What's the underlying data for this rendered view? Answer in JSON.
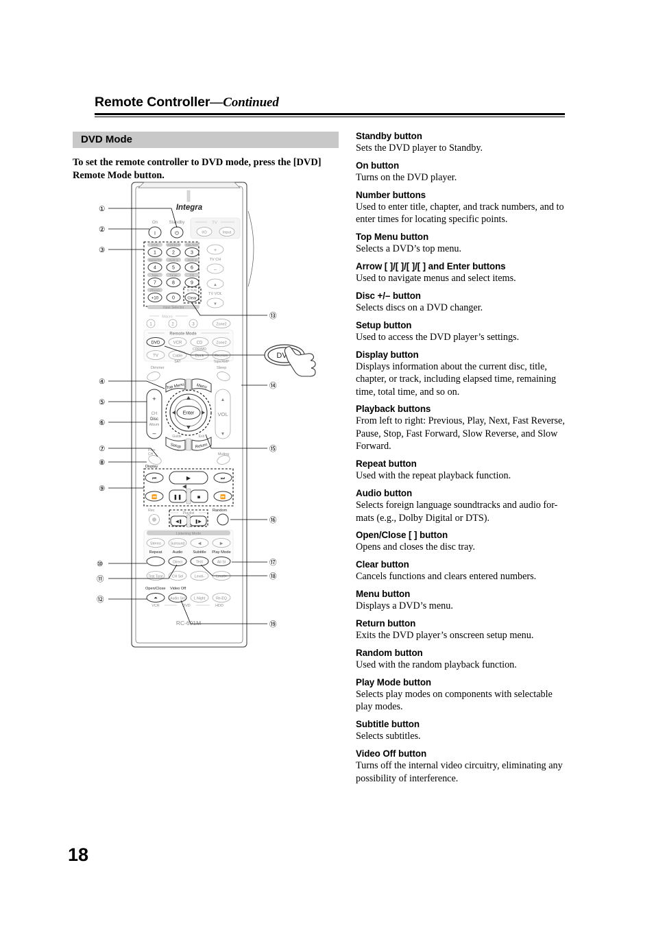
{
  "header": {
    "title_main": "Remote Controller",
    "title_cont": "—Continued"
  },
  "left": {
    "section_title": "DVD Mode",
    "intro": "To set the remote controller to DVD mode, press the [DVD] Remote Mode button."
  },
  "right": {
    "entries": [
      {
        "title": "Standby button",
        "body": "Sets the DVD player to Standby."
      },
      {
        "title": "On button",
        "body": "Turns on the DVD player."
      },
      {
        "title": "Number buttons",
        "body": "Used to enter title, chapter, and track numbers, and to enter times for locating specific points."
      },
      {
        "title": "Top Menu button",
        "body": "Selects a DVD’s top menu."
      },
      {
        "title": "Arrow [   ]/[   ]/[   ]/[   ] and Enter buttons",
        "body": "Used to navigate menus and select items."
      },
      {
        "title": "Disc +/– button",
        "body": "Selects discs on a DVD changer."
      },
      {
        "title": "Setup button",
        "body": "Used to access the DVD player’s settings."
      },
      {
        "title": "Display button",
        "body": "Displays information about the current disc, title, chapter, or track, including elapsed time, remaining time, total time, and so on."
      },
      {
        "title": "Playback buttons",
        "body": "From left to right: Previous, Play, Next, Fast Reverse, Pause, Stop, Fast Forward, Slow Reverse, and Slow Forward."
      },
      {
        "title": "Repeat button",
        "body": "Used with the repeat playback function."
      },
      {
        "title": "Audio button",
        "body": "Selects foreign language soundtracks and audio for-mats (e.g., Dolby Digital or DTS)."
      },
      {
        "title": "Open/Close [   ] button",
        "body": "Opens and closes the disc tray."
      },
      {
        "title": "Clear button",
        "body": "Cancels functions and clears entered numbers."
      },
      {
        "title": "Menu button",
        "body": "Displays a DVD’s menu."
      },
      {
        "title": "Return button",
        "body": "Exits the DVD player’s onscreen setup menu."
      },
      {
        "title": "Random button",
        "body": "Used with the random playback function."
      },
      {
        "title": "Play Mode button",
        "body": "Selects play modes on components with selectable play modes."
      },
      {
        "title": "Subtitle button",
        "body": "Selects subtitles."
      },
      {
        "title": "Video Off button",
        "body": "Turns off the internal video circuitry, eliminating any possibility of interference."
      }
    ]
  },
  "figure": {
    "brand": "Integra",
    "model": "RC-691M",
    "callout_button_label": "DVD",
    "callouts_left": [
      "①",
      "②",
      "③",
      "④",
      "⑤",
      "⑥",
      "⑦",
      "⑧",
      "⑨",
      "⑩",
      "⑪",
      "⑫"
    ],
    "callouts_right": [
      "⑬",
      "⑭",
      "⑮",
      "⑯",
      "⑰",
      "⑱",
      "⑲"
    ],
    "power": {
      "on": "On",
      "standby": "Standby"
    },
    "tv_group": {
      "label": "TV",
      "power": "I/⏻",
      "input": "Input"
    },
    "keypad": {
      "top_labels": [
        "DVD",
        "VCR/DVR",
        "CBL/SAT",
        "Game/TV",
        "AUX 1",
        "AUX 2",
        "Tape",
        "Tuner",
        "CD",
        "Phono"
      ],
      "keys": [
        "1",
        "2",
        "3",
        "4",
        "5",
        "6",
        "7",
        "8",
        "9",
        "+10",
        "0"
      ],
      "dtun_label": "D.TUN",
      "clear_key": "Clear",
      "selector_label": "Input Selector"
    },
    "tv_side": {
      "ch": "TV CH",
      "vol": "TV VOL",
      "plus": "+",
      "minus": "–",
      "up": "▲",
      "down": "▼"
    },
    "macro": {
      "label": "Macro",
      "keys": [
        "1",
        "2",
        "3"
      ],
      "zone": "Zone2"
    },
    "remote_mode": {
      "label": "Remote Mode",
      "row1": [
        "DVD",
        "VCR",
        "CD",
        "Zone2"
      ],
      "row1_sub": [
        "",
        "",
        "CDR/MD",
        ""
      ],
      "row2": [
        "TV",
        "Cable",
        "Dock",
        "Receiver"
      ],
      "row2_sub": [
        "",
        "SAT",
        "",
        "Tape/AMP"
      ]
    },
    "nav": {
      "dimmer": "Dimmer",
      "sleep": "Sleep",
      "top_menu": "Top Menu",
      "menu": "Menu",
      "enter": "Enter",
      "disc_plus": "+",
      "disc_minus": "–",
      "ch": "CH",
      "disc": "Disc",
      "album": "Album",
      "vol": "VOL",
      "setup": "Setup",
      "return": "Return",
      "prev_ch": "Prev CH",
      "muting": "Muting",
      "display": "Display"
    },
    "playback": {
      "prev": "⏮",
      "play": "▶",
      "next": "⏭",
      "frev": "◀◀",
      "pause": "❙❙",
      "stop": "■",
      "ffwd": "▶▶",
      "slow_rev": "◀❙",
      "slow_fwd": "❙▶",
      "playlist": "Playlist",
      "rec": "Rec",
      "random": "Random"
    },
    "listening": {
      "label": "Listening Mode",
      "keys": [
        "Stereo",
        "Surround",
        "◀",
        "▶"
      ]
    },
    "dvd_row": {
      "labels": [
        "Repeat",
        "Audio",
        "Subtitle",
        "Play Mode"
      ],
      "sub_keys": [
        "",
        "Direct",
        "THX",
        "All St"
      ]
    },
    "level_row": [
      "Test Tone",
      "CH Sel",
      "Level-",
      "Level+"
    ],
    "bottom_row": {
      "labels": [
        "Open/Close",
        "Video Off",
        "",
        ""
      ],
      "keys": [
        "⏏",
        "Audio Sel",
        "L Night",
        "Re-EQ"
      ]
    },
    "device_strip": [
      "VCR",
      "DVD",
      "HDD"
    ]
  }
}
